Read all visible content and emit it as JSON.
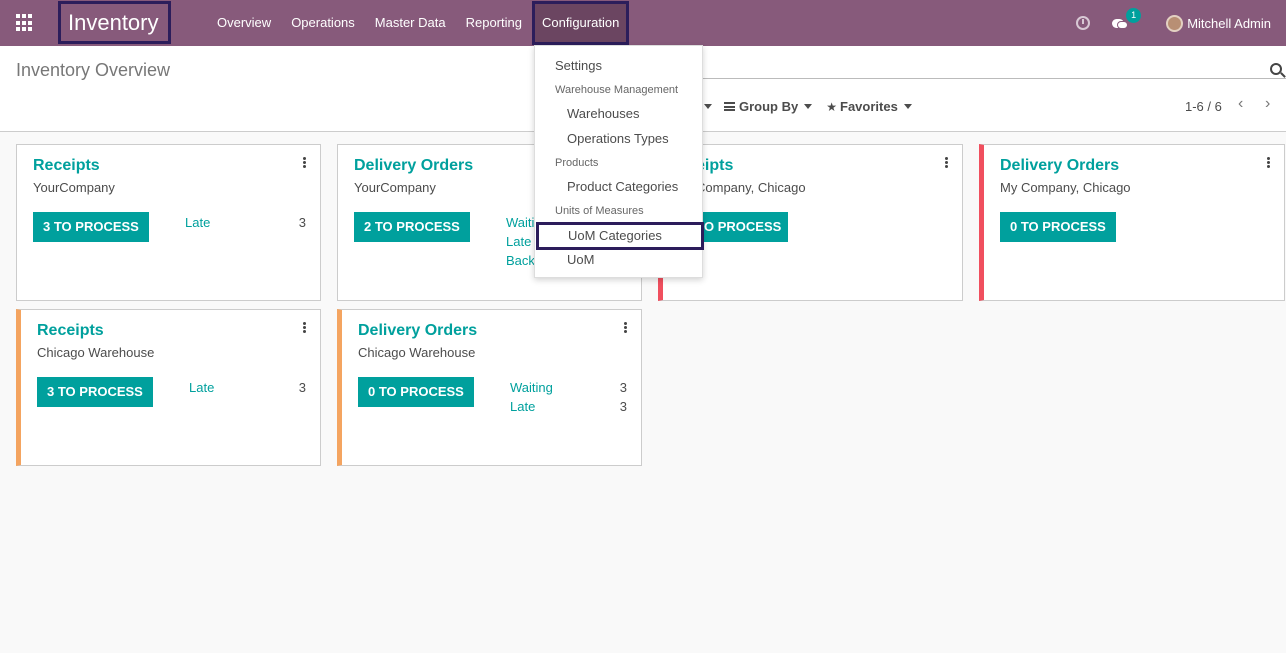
{
  "navbar": {
    "app_title": "Inventory",
    "menu": [
      "Overview",
      "Operations",
      "Master Data",
      "Reporting",
      "Configuration"
    ],
    "messages_count": "1",
    "user_name": "Mitchell Admin"
  },
  "control_panel": {
    "breadcrumb": "Inventory Overview",
    "group_by": "Group By",
    "favorites": "Favorites",
    "pager": "1-6 / 6"
  },
  "dropdown": {
    "settings": "Settings",
    "header_warehouse": "Warehouse Management",
    "warehouses": "Warehouses",
    "operations_types": "Operations Types",
    "header_products": "Products",
    "product_categories": "Product Categories",
    "header_uom": "Units of Measures",
    "uom_categories": "UoM Categories",
    "uom": "UoM"
  },
  "cards": [
    {
      "title": "Receipts",
      "subtitle": "YourCompany",
      "button": "3 TO PROCESS",
      "stats": [
        {
          "label": "Late",
          "count": "3"
        }
      ]
    },
    {
      "title": "Delivery Orders",
      "subtitle": "YourCompany",
      "button": "2 TO PROCESS",
      "stats": [
        {
          "label": "Waiti",
          "count": ""
        },
        {
          "label": "Late",
          "count": ""
        },
        {
          "label": "Back",
          "count": ""
        }
      ]
    },
    {
      "title": "eipts",
      "subtitle": "Company, Chicago",
      "button": "O PROCESS",
      "stats": []
    },
    {
      "title": "Delivery Orders",
      "subtitle": "My Company, Chicago",
      "button": "0 TO PROCESS",
      "stats": []
    },
    {
      "title": "Receipts",
      "subtitle": "Chicago Warehouse",
      "button": "3 TO PROCESS",
      "stats": [
        {
          "label": "Late",
          "count": "3"
        }
      ]
    },
    {
      "title": "Delivery Orders",
      "subtitle": "Chicago Warehouse",
      "button": "0 TO PROCESS",
      "stats": [
        {
          "label": "Waiting",
          "count": "3"
        },
        {
          "label": "Late",
          "count": "3"
        }
      ]
    }
  ],
  "colors": {
    "navbar": "#875a7b",
    "accent": "#00a09d",
    "highlight_border": "#2c1d5b",
    "status_red": "#f04f5e",
    "status_orange": "#f4a460"
  },
  "icons": [
    "apps-grid-icon",
    "clock-icon",
    "chat-icon",
    "search-icon",
    "kebab-icon",
    "star-icon",
    "chevron-left-icon",
    "chevron-right-icon"
  ]
}
